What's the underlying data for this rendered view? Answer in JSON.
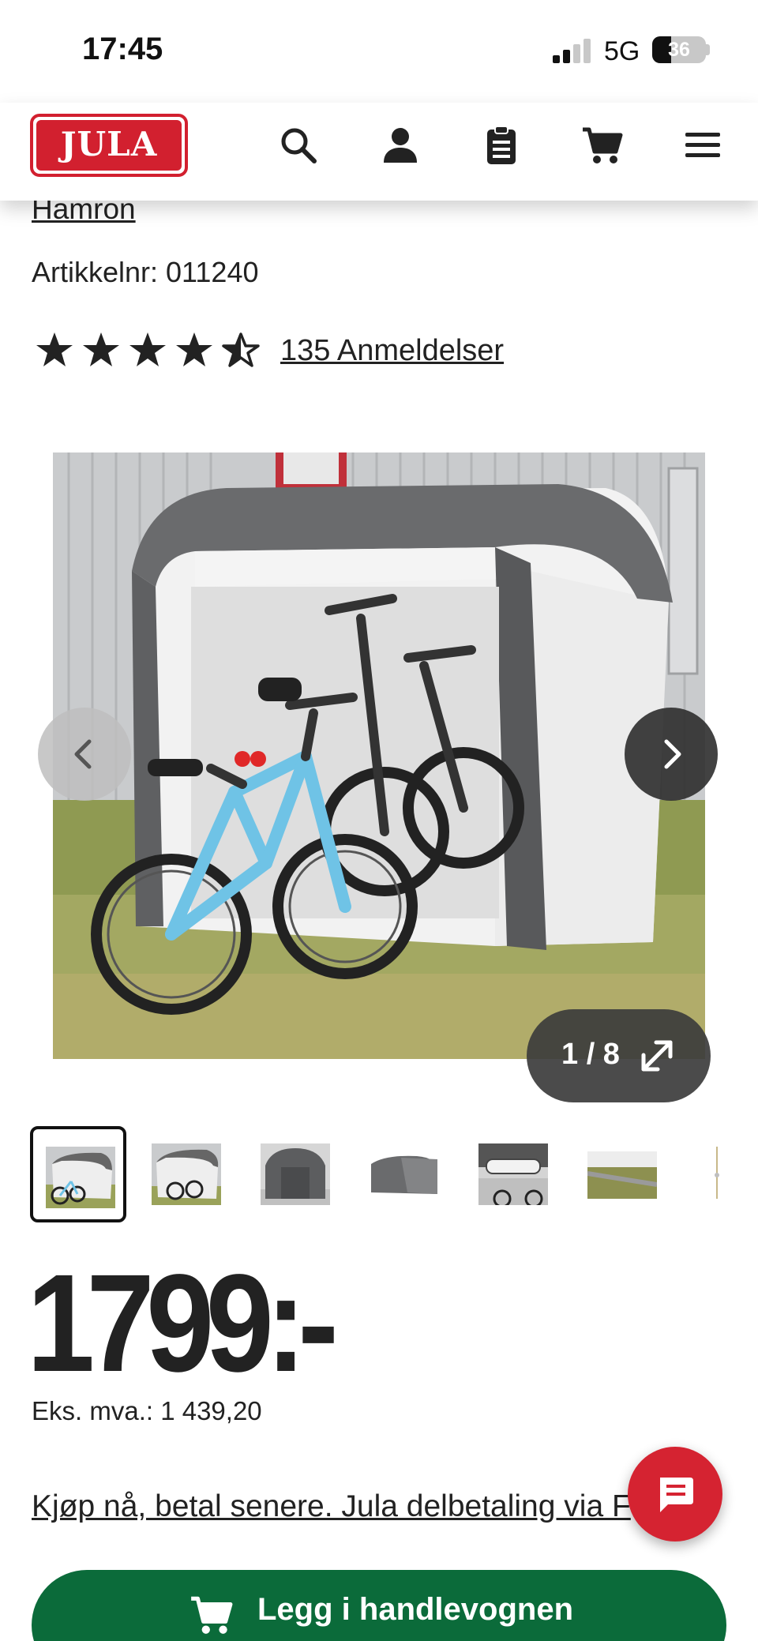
{
  "status_bar": {
    "time": "17:45",
    "network": "5G",
    "battery": "36",
    "battery_level": 0.36
  },
  "header": {
    "logo_text": "JULA",
    "icons": [
      "search-icon",
      "account-icon",
      "shopping-list-icon",
      "cart-icon",
      "menu-icon"
    ]
  },
  "product": {
    "brand": "Hamron",
    "article_number": "Artikkelnr: 011240",
    "rating": 4.5,
    "reviews_label": "135 Anmeldelser"
  },
  "gallery": {
    "counter": "1 / 8",
    "current_index": 1,
    "total": 8,
    "thumbnail_count": 7
  },
  "pricing": {
    "price": "1799:-",
    "vat_excluded": "Eks. mva.: 1 439,20",
    "installment_link": "Kjøp nå, betal senere. Jula delbetaling via F"
  },
  "actions": {
    "add_to_cart": "Legg i handlevognen"
  },
  "colors": {
    "brand_red": "#d2202f",
    "cart_green": "#0b6b3a",
    "chat_red": "#d52331"
  }
}
